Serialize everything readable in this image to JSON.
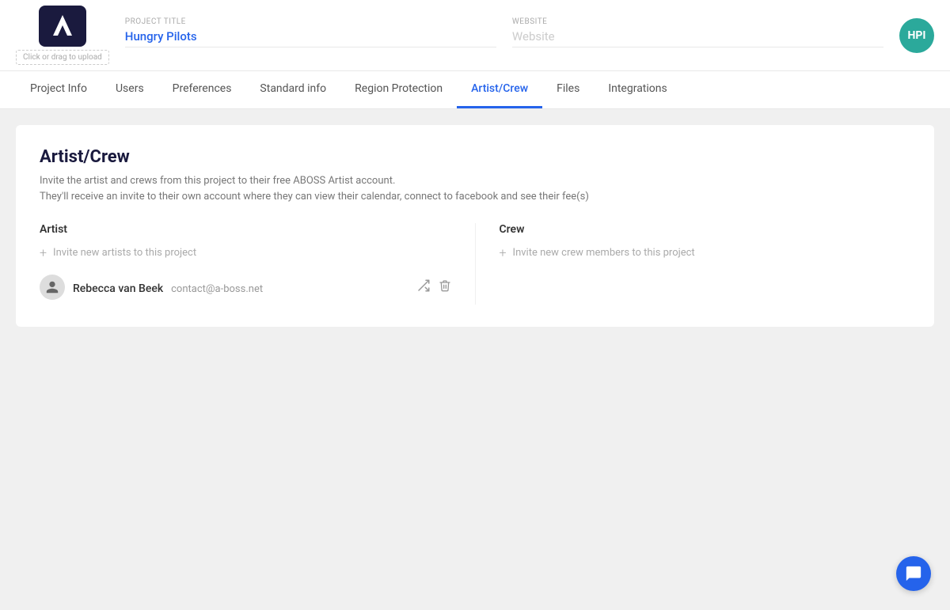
{
  "header": {
    "upload_label": "Click or drag to upload",
    "project_label": "PROJECT TITLE",
    "project_value": "Hungry Pilots",
    "website_label": "WEBSITE",
    "website_placeholder": "Website",
    "avatar_initials": "HPI"
  },
  "tabs": [
    {
      "id": "project-info",
      "label": "Project Info"
    },
    {
      "id": "users",
      "label": "Users"
    },
    {
      "id": "preferences",
      "label": "Preferences"
    },
    {
      "id": "standard-info",
      "label": "Standard info"
    },
    {
      "id": "region-protection",
      "label": "Region Protection"
    },
    {
      "id": "artist-crew",
      "label": "Artist/Crew",
      "active": true
    },
    {
      "id": "files",
      "label": "Files"
    },
    {
      "id": "integrations",
      "label": "Integrations"
    }
  ],
  "main": {
    "title": "Artist/Crew",
    "description_line1": "Invite the artist and crews from this project to their free ABOSS Artist account.",
    "description_line2": "They'll receive an invite to their own account where they can view their calendar, connect to facebook and see their fee(s)",
    "artist_section": {
      "title": "Artist",
      "invite_label": "Invite new artists to this project",
      "artist": {
        "name": "Rebecca van Beek",
        "email": "contact@a-boss.net"
      }
    },
    "crew_section": {
      "title": "Crew",
      "invite_label": "Invite new crew members to this project"
    }
  }
}
